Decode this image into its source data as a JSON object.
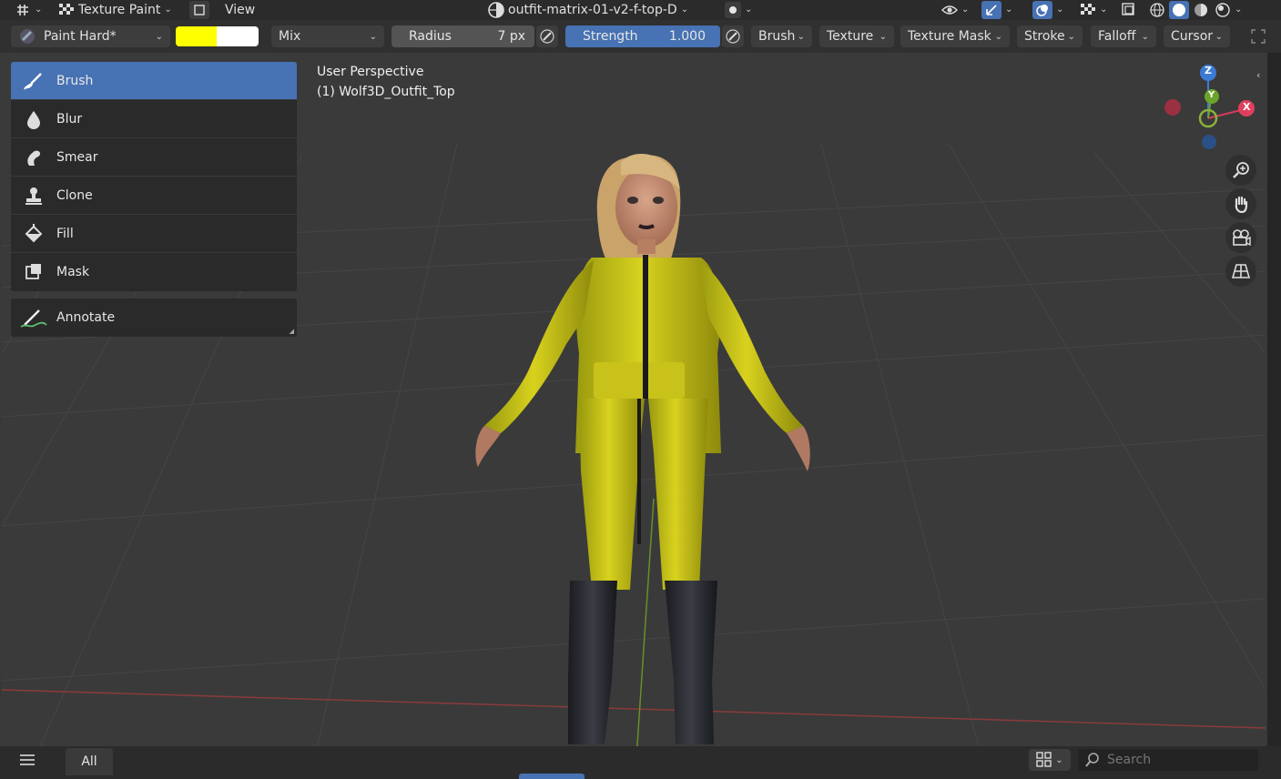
{
  "header": {
    "mode_label": "Texture Paint",
    "view_label": "View",
    "texture_name": "outfit-matrix-01-v2-f-top-D"
  },
  "toolbar": {
    "brush_name": "Paint Hard*",
    "colors": {
      "primary": "#ffff00",
      "secondary": "#ffffff"
    },
    "blend_mode": "Mix",
    "radius_label": "Radius",
    "radius_value": "7 px",
    "strength_label": "Strength",
    "strength_value": "1.000",
    "strength_fraction": 1.0,
    "menus": [
      "Brush",
      "Texture",
      "Texture Mask",
      "Stroke",
      "Falloff",
      "Cursor"
    ]
  },
  "tools": [
    {
      "label": "Brush",
      "icon": "brush-icon",
      "active": true
    },
    {
      "label": "Blur",
      "icon": "blur-drop-icon",
      "active": false
    },
    {
      "label": "Smear",
      "icon": "smear-icon",
      "active": false
    },
    {
      "label": "Clone",
      "icon": "clone-stamp-icon",
      "active": false
    },
    {
      "label": "Fill",
      "icon": "fill-bucket-icon",
      "active": false
    },
    {
      "label": "Mask",
      "icon": "mask-icon",
      "active": false
    }
  ],
  "annotate_label": "Annotate",
  "viewport": {
    "perspective": "User Perspective",
    "object": "(1) Wolf3D_Outfit_Top"
  },
  "gizmo": {
    "x": "X",
    "y": "Y",
    "z": "Z"
  },
  "bottom": {
    "filter_label": "All",
    "search_placeholder": "Search"
  },
  "accent_color": "#4772b3"
}
